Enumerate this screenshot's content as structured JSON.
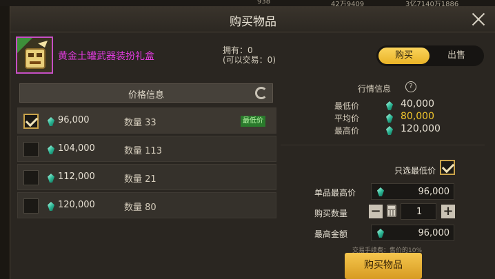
{
  "topbar": {
    "a": "938",
    "b": "42万9409",
    "c": "3亿7140万1886"
  },
  "dialog": {
    "title": "购买物品"
  },
  "item": {
    "name": "黄金土罐武器装扮礼盒",
    "owned_line1": "拥有：0",
    "owned_line2": "(可以交易：0)"
  },
  "mode_toggle": {
    "buy_label": "购买",
    "sell_label": "出售",
    "selected": "buy"
  },
  "price_info": {
    "header": "价格信息",
    "rows": [
      {
        "price": "96,000",
        "qty_label": "数量",
        "qty": "33",
        "tag": "最低价",
        "selected": true
      },
      {
        "price": "104,000",
        "qty_label": "数量",
        "qty": "113",
        "selected": false
      },
      {
        "price": "112,000",
        "qty_label": "数量",
        "qty": "21",
        "selected": false
      },
      {
        "price": "120,000",
        "qty_label": "数量",
        "qty": "80",
        "selected": false
      }
    ]
  },
  "market": {
    "header": "行情信息",
    "help_icon": "?",
    "rows": [
      {
        "label": "最低价",
        "value": "40,000"
      },
      {
        "label": "平均价",
        "value": "80,000"
      },
      {
        "label": "最高价",
        "value": "120,000"
      }
    ]
  },
  "purchase_form": {
    "only_lowest_label": "只选最低价",
    "only_lowest_checked": true,
    "unit_max_label": "单品最高价",
    "unit_max_value": "96,000",
    "qty_label": "购买数量",
    "qty_value": "1",
    "minus": "−",
    "plus": "+",
    "max_total_label": "最高金额",
    "max_total_value": "96,000",
    "fee_note": "交易手续费：售价的10%",
    "buy_button": "购买物品"
  },
  "colors": {
    "accent": "#f2c33b",
    "item_rarity": "#e23be0",
    "gem": "#2bb594",
    "lowest_tag": "#2a7a2c"
  }
}
